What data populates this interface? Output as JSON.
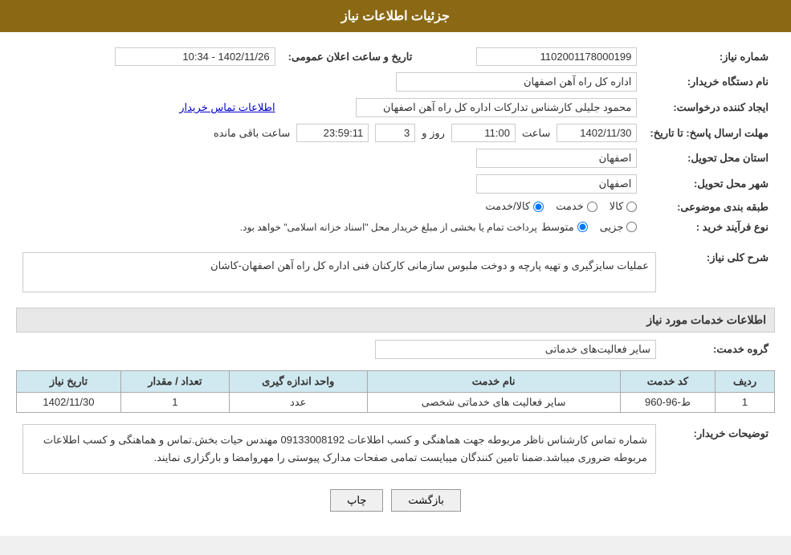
{
  "header": {
    "title": "جزئیات اطلاعات نیاز"
  },
  "fields": {
    "need_number_label": "شماره نیاز:",
    "need_number_value": "1102001178000199",
    "buyer_org_label": "نام دستگاه خریدار:",
    "buyer_org_value": "اداره کل راه آهن اصفهان",
    "requester_label": "ایجاد کننده درخواست:",
    "requester_value": "محمود جلیلی کارشناس تدارکات اداره کل راه آهن اصفهان",
    "requester_contact": "اطلاعات تماس خریدار",
    "announce_datetime_label": "تاریخ و ساعت اعلان عمومی:",
    "announce_datetime_value": "1402/11/26 - 10:34",
    "response_deadline_label": "مهلت ارسال پاسخ: تا تاریخ:",
    "response_date": "1402/11/30",
    "response_time_label": "ساعت",
    "response_time": "11:00",
    "remaining_days_label": "روز و",
    "remaining_days": "3",
    "remaining_time_label": "ساعت باقی مانده",
    "remaining_time": "23:59:11",
    "province_delivery_label": "استان محل تحویل:",
    "province_delivery_value": "اصفهان",
    "city_delivery_label": "شهر محل تحویل:",
    "city_delivery_value": "اصفهان",
    "topic_category_label": "طبقه بندی موضوعی:",
    "topic_kala": "کالا",
    "topic_khedmat": "خدمت",
    "topic_kala_khedmat": "کالا/خدمت",
    "process_type_label": "نوع فرآیند خرید :",
    "process_jezvi": "جزیی",
    "process_mottaset": "متوسط",
    "process_note": "پرداخت تمام یا بخشی از مبلغ خریدار محل \"اسناد خزانه اسلامی\" خواهد بود.",
    "need_description_label": "شرح کلی نیاز:",
    "need_description": "عملیات سایزگیری و تهیه پارچه و دوخت ملبوس سازمانی کارکنان فنی اداره کل راه آهن اصفهان-کاشان",
    "services_section_label": "اطلاعات خدمات مورد نیاز",
    "service_group_label": "گروه خدمت:",
    "service_group_value": "سایر فعالیت‌های خدماتی",
    "table_headers": {
      "row_num": "ردیف",
      "service_code": "کد خدمت",
      "service_name": "نام خدمت",
      "unit": "واحد اندازه گیری",
      "quantity": "تعداد / مقدار",
      "date": "تاریخ نیاز"
    },
    "table_rows": [
      {
        "row_num": "1",
        "service_code": "ط-96-960",
        "service_name": "سایر فعالیت های خدماتی شخصی",
        "unit": "عدد",
        "quantity": "1",
        "date": "1402/11/30"
      }
    ],
    "buyer_notes_label": "توضیحات خریدار:",
    "buyer_notes": "شماره تماس کارشناس ناظر  مربوطه جهت هماهنگی و کسب اطلاعات 09133008192 مهندس حیات بخش.تماس و هماهنگی و کسب اطلاعات مربوطه ضروری میباشد.ضمنا تامین کنندگان میبایست تمامی صفحات مدارک پیوستی را مهروامضا و بارگزاری نمایند.",
    "buttons": {
      "back": "بازگشت",
      "print": "چاپ"
    }
  }
}
